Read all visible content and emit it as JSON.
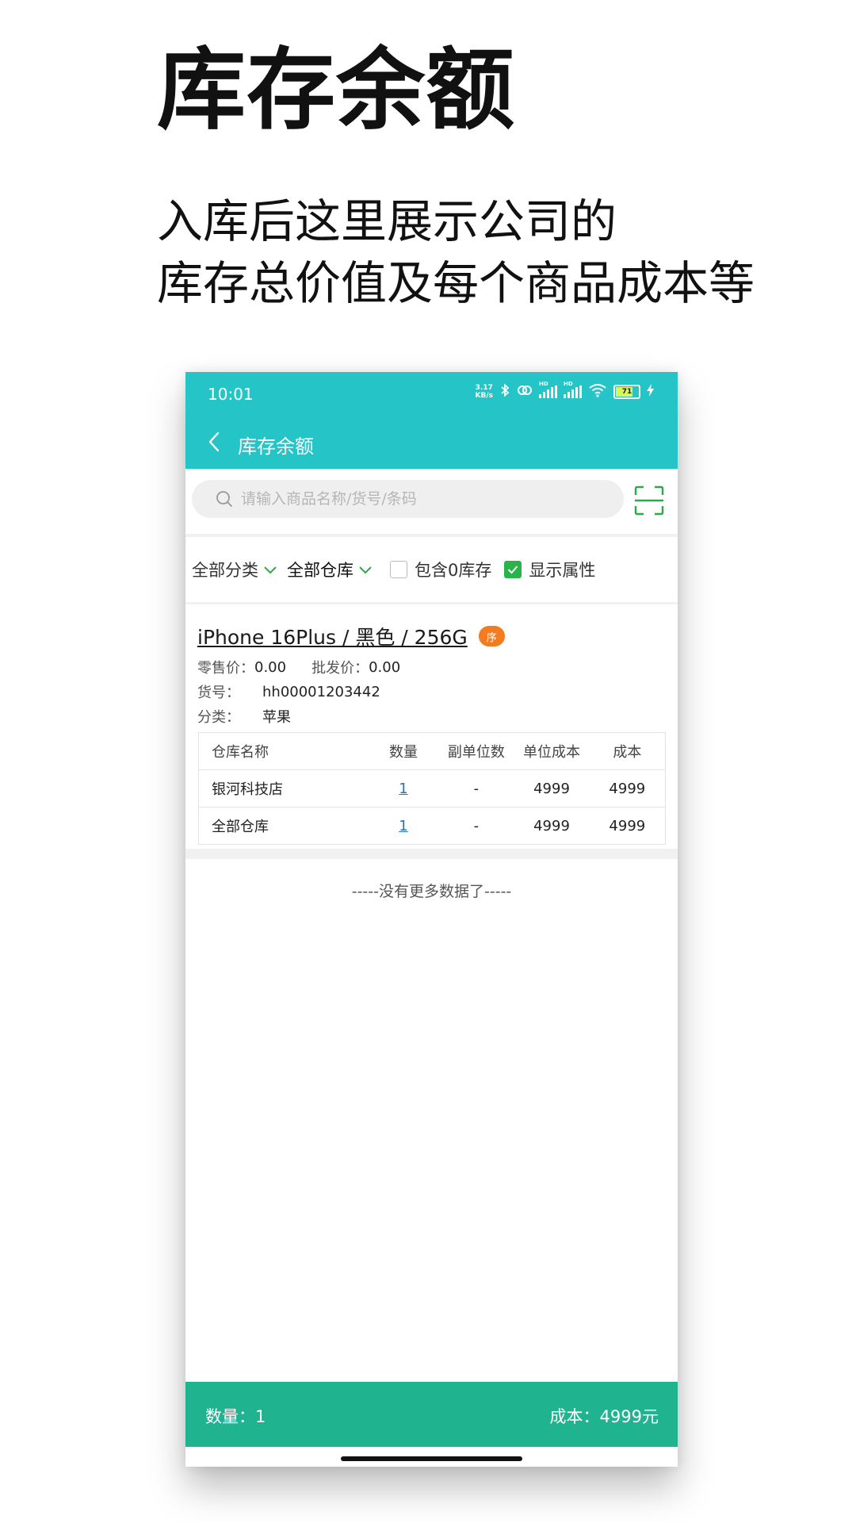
{
  "promo": {
    "title": "库存余额",
    "subtitle_line1": "入库后这里展示公司的",
    "subtitle_line2": "库存总价值及每个商品成本等"
  },
  "status_bar": {
    "time": "10:01",
    "net_speed_value": "3.17",
    "net_speed_unit": "KB/s",
    "sim1_label": "HD",
    "sim2_label": "HD",
    "battery_level": "71"
  },
  "nav": {
    "title": "库存余额"
  },
  "search": {
    "placeholder": "请输入商品名称/货号/条码",
    "value": ""
  },
  "filters": {
    "category": "全部分类",
    "warehouse": "全部仓库",
    "include_zero": {
      "label": "包含0库存",
      "checked": false
    },
    "show_attrs": {
      "label": "显示属性",
      "checked": true
    }
  },
  "product": {
    "name": "iPhone 16Plus / 黑色 / 256G",
    "badge": "序",
    "retail_label": "零售价：",
    "retail_value": "0.00",
    "wholesale_label": "批发价：",
    "wholesale_value": "0.00",
    "sku_label": "货号：",
    "sku_value": "hh00001203442",
    "category_label": "分类：",
    "category_value": "苹果",
    "table": {
      "headers": [
        "仓库名称",
        "数量",
        "副单位数",
        "单位成本",
        "成本"
      ],
      "rows": [
        {
          "warehouse": "银河科技店",
          "qty": "1",
          "sub_units": "-",
          "unit_cost": "4999",
          "cost": "4999"
        },
        {
          "warehouse": "全部仓库",
          "qty": "1",
          "sub_units": "-",
          "unit_cost": "4999",
          "cost": "4999"
        }
      ]
    }
  },
  "list_end_text": "-----没有更多数据了-----",
  "footer": {
    "qty_text": "数量：1",
    "cost_text": "成本：4999元"
  },
  "colors": {
    "header_teal": "#25c4c6",
    "footer_green": "#1fb38f",
    "badge_orange": "#f27c1f",
    "checkbox_green": "#29b34a",
    "link_blue": "#1f73c9"
  }
}
